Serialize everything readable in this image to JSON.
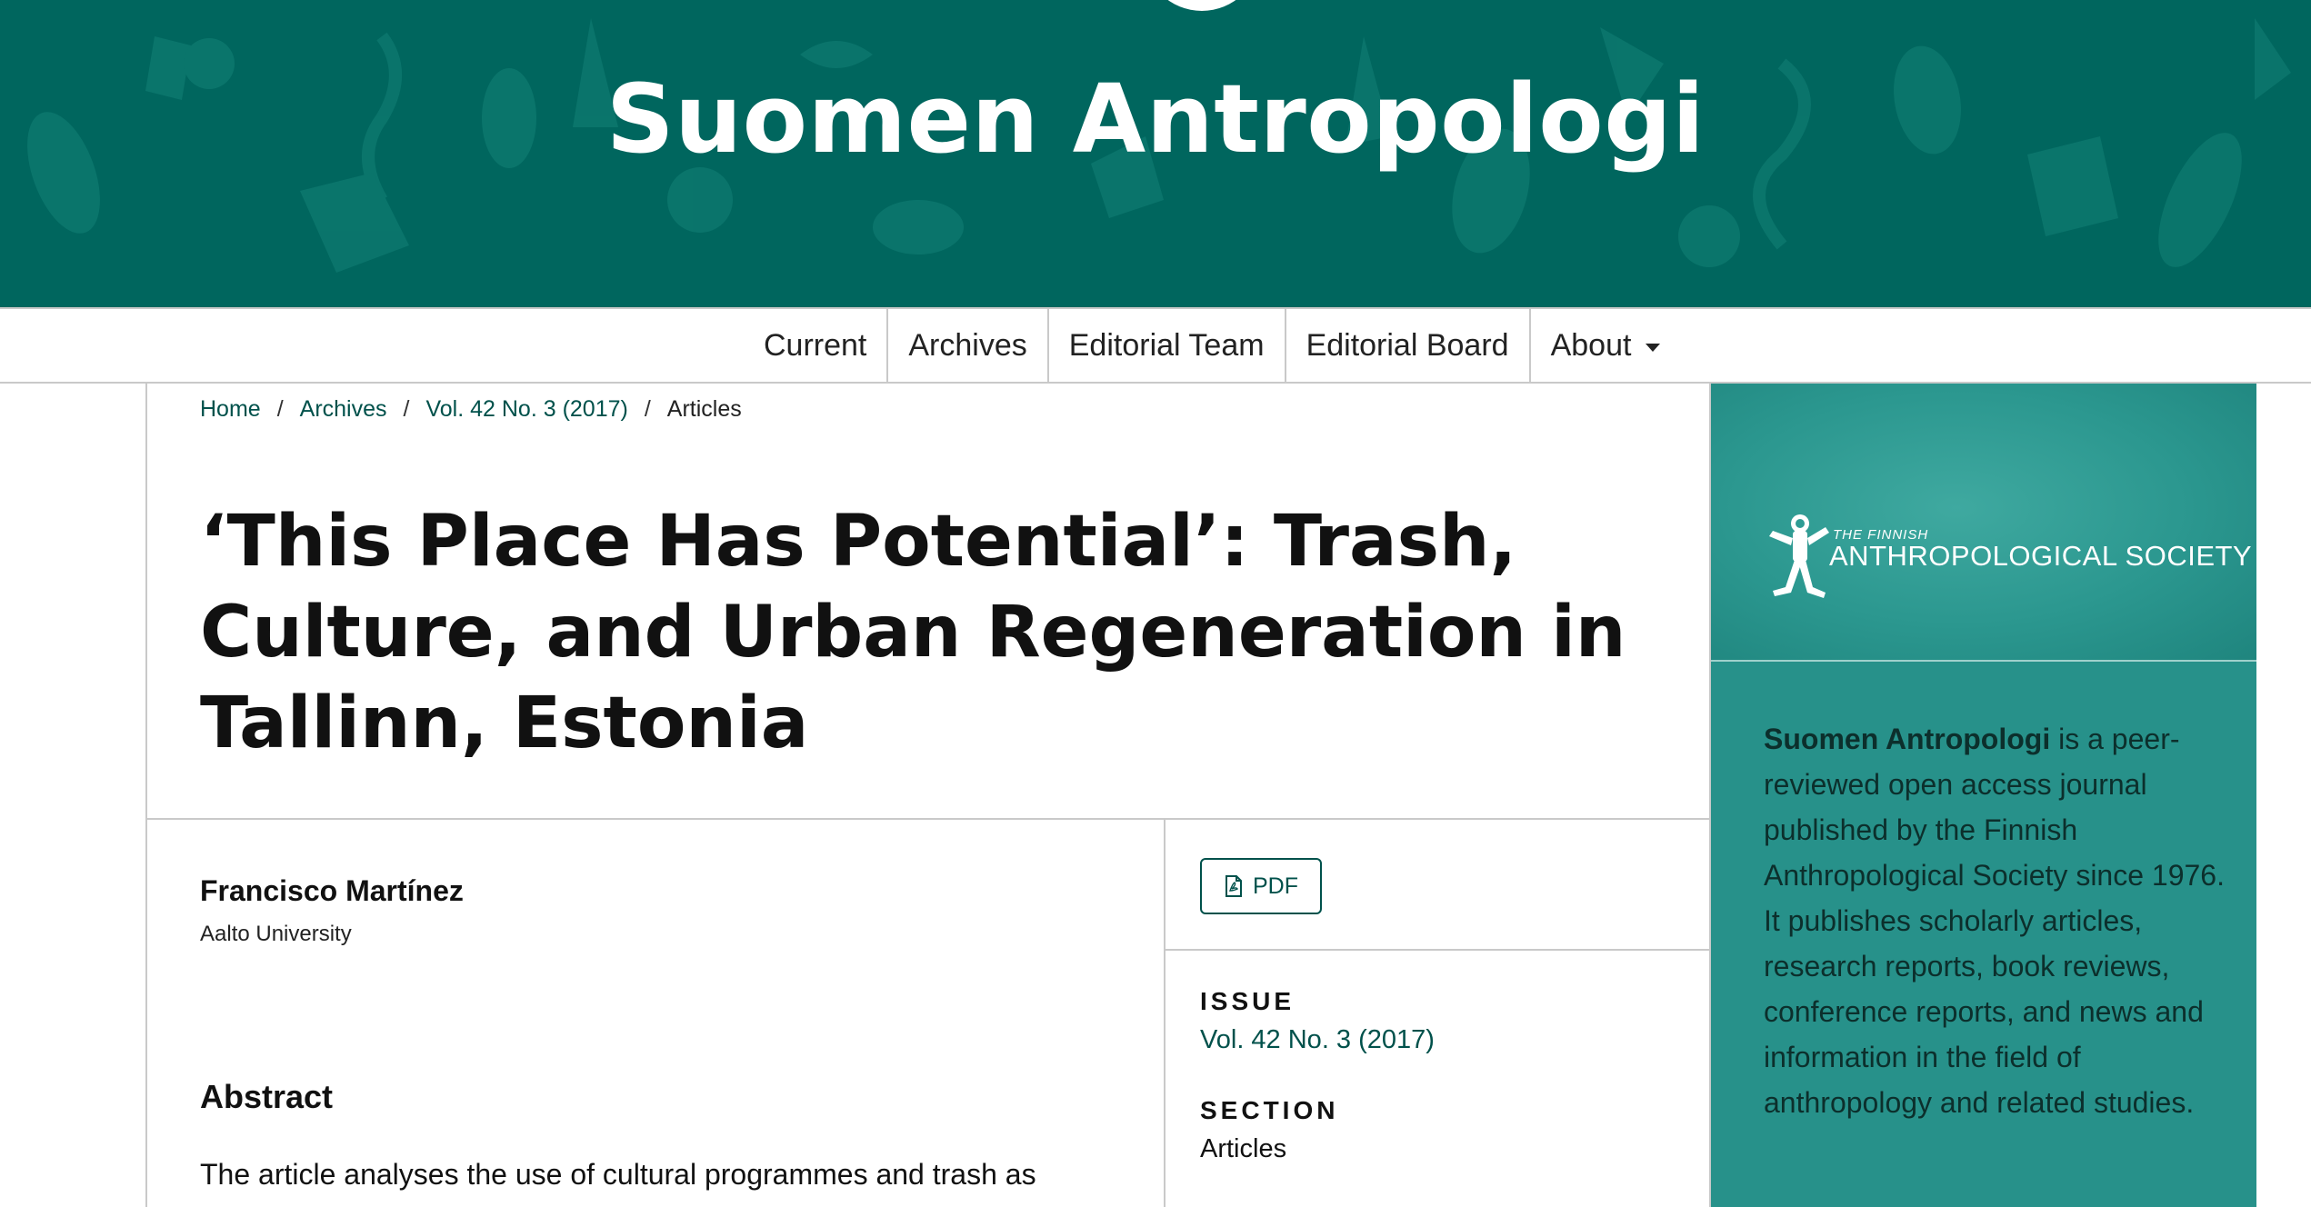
{
  "header": {
    "site_title": "Suomen Antropologi",
    "background_color": "#00665e"
  },
  "nav": {
    "items": [
      {
        "label": "Current"
      },
      {
        "label": "Archives"
      },
      {
        "label": "Editorial Team"
      },
      {
        "label": "Editorial Board"
      },
      {
        "label": "About",
        "has_dropdown": true
      }
    ]
  },
  "breadcrumb": {
    "items": [
      "Home",
      "Archives",
      "Vol. 42 No. 3 (2017)",
      "Articles"
    ],
    "separator": "/"
  },
  "article": {
    "title": "‘This Place Has Potential’: Trash, Culture, and Urban Regeneration in Tallinn, Estonia",
    "author_name": "Francisco Martínez",
    "author_affiliation": "Aalto University",
    "abstract_heading": "Abstract",
    "abstract_text": "The article analyses the use of cultural programmes and trash as"
  },
  "galley": {
    "pdf_label": "PDF",
    "pdf_icon": "pdf-file-icon"
  },
  "meta": {
    "issue_label": "ISSUE",
    "issue_value": "Vol. 42 No. 3 (2017)",
    "section_label": "SECTION",
    "section_value": "Articles"
  },
  "sidebar": {
    "logo_small": "THE FINNISH",
    "logo_big": "ANTHROPOLOGICAL SOCIETY",
    "description_bold": "Suomen Antropologi",
    "description_rest": " is a peer-reviewed open access journal published by the Finnish Anthropological Society since 1976. It publishes scholarly articles, research reports, book reviews, conference reports, and news and information in the field of anthropology and related studies.",
    "background_color": "#27918a"
  },
  "colors": {
    "link": "#00514b",
    "divider": "#c9c9c9"
  }
}
